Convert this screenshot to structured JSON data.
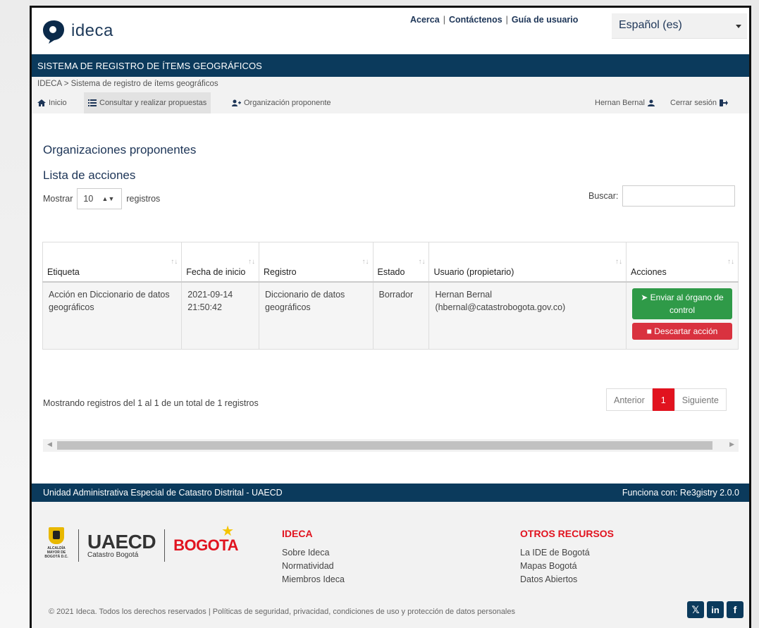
{
  "header": {
    "logo_text": "ideca",
    "links": [
      "Acerca",
      "Contáctenos",
      "Guía de usuario"
    ],
    "language": "Español (es)"
  },
  "system_title": "SISTEMA DE REGISTRO DE ÍTEMS GEOGRÁFICOS",
  "breadcrumb": "IDECA > Sistema de registro de ítems geográficos",
  "menu": {
    "home": "Inicio",
    "consult": "Consultar y realizar propuestas",
    "org": "Organización proponente",
    "user": "Hernan Bernal",
    "logout": "Cerrar sesión"
  },
  "page": {
    "title": "Organizaciones proponentes",
    "subtitle": "Lista de acciones",
    "show_label": "Mostrar",
    "show_value": "10",
    "records_label": "registros",
    "search_label": "Buscar:",
    "search_value": ""
  },
  "table": {
    "headers": [
      "Etiqueta",
      "Fecha de inicio",
      "Registro",
      "Estado",
      "Usuario (propietario)",
      "Acciones"
    ],
    "rows": [
      {
        "etiqueta": "Acción en Diccionario de datos geográficos",
        "fecha": "2021-09-14 21:50:42",
        "registro": "Diccionario de datos geográficos",
        "estado": "Borrador",
        "usuario": "Hernan Bernal (hbernal@catastrobogota.gov.co)",
        "btn_send": "Enviar al órgano de control",
        "btn_discard": "Descartar acción"
      }
    ]
  },
  "pagination": {
    "info": "Mostrando registros del 1 al 1 de un total de 1 registros",
    "prev": "Anterior",
    "current": "1",
    "next": "Siguiente"
  },
  "footer": {
    "left": "Unidad Administrativa Especial de Catastro Distrital - UAECD",
    "right": "Funciona con: Re3gistry 2.0.0",
    "logo_caption": "ALCALDÍA MAYOR DE BOGOTÁ D.C.",
    "uaecd": "UAECD",
    "uaecd_sub": "Catastro Bogotá",
    "bogota": "BOGOTA",
    "col1_title": "IDECA",
    "col1": [
      "Sobre Ideca",
      "Normatividad",
      "Miembros Ideca"
    ],
    "col2_title": "OTROS RECURSOS",
    "col2": [
      "La IDE de Bogotá",
      "Mapas Bogotá",
      "Datos Abiertos"
    ],
    "copyright": "© 2021 Ideca. Todos los derechos reservados  |  Políticas de seguridad, privacidad, condiciones de uso y protección de datos personales",
    "social": [
      "twitter-icon",
      "linkedin-icon",
      "facebook-icon"
    ]
  },
  "colors": {
    "navy": "#0b3a5c",
    "red": "#e1131f",
    "green": "#2f9a48"
  }
}
